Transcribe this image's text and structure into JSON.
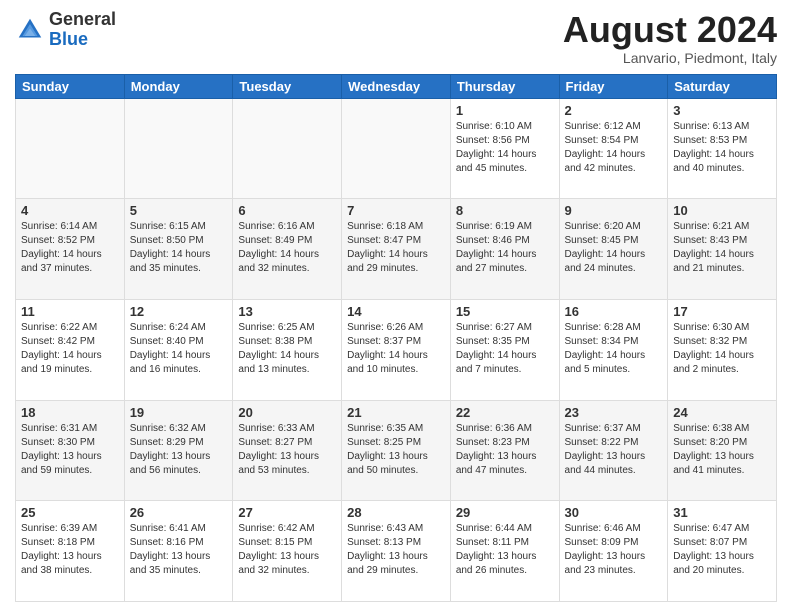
{
  "header": {
    "logo_general": "General",
    "logo_blue": "Blue",
    "month_title": "August 2024",
    "subtitle": "Lanvario, Piedmont, Italy"
  },
  "days_of_week": [
    "Sunday",
    "Monday",
    "Tuesday",
    "Wednesday",
    "Thursday",
    "Friday",
    "Saturday"
  ],
  "weeks": [
    [
      {
        "day": "",
        "info": ""
      },
      {
        "day": "",
        "info": ""
      },
      {
        "day": "",
        "info": ""
      },
      {
        "day": "",
        "info": ""
      },
      {
        "day": "1",
        "info": "Sunrise: 6:10 AM\nSunset: 8:56 PM\nDaylight: 14 hours\nand 45 minutes."
      },
      {
        "day": "2",
        "info": "Sunrise: 6:12 AM\nSunset: 8:54 PM\nDaylight: 14 hours\nand 42 minutes."
      },
      {
        "day": "3",
        "info": "Sunrise: 6:13 AM\nSunset: 8:53 PM\nDaylight: 14 hours\nand 40 minutes."
      }
    ],
    [
      {
        "day": "4",
        "info": "Sunrise: 6:14 AM\nSunset: 8:52 PM\nDaylight: 14 hours\nand 37 minutes."
      },
      {
        "day": "5",
        "info": "Sunrise: 6:15 AM\nSunset: 8:50 PM\nDaylight: 14 hours\nand 35 minutes."
      },
      {
        "day": "6",
        "info": "Sunrise: 6:16 AM\nSunset: 8:49 PM\nDaylight: 14 hours\nand 32 minutes."
      },
      {
        "day": "7",
        "info": "Sunrise: 6:18 AM\nSunset: 8:47 PM\nDaylight: 14 hours\nand 29 minutes."
      },
      {
        "day": "8",
        "info": "Sunrise: 6:19 AM\nSunset: 8:46 PM\nDaylight: 14 hours\nand 27 minutes."
      },
      {
        "day": "9",
        "info": "Sunrise: 6:20 AM\nSunset: 8:45 PM\nDaylight: 14 hours\nand 24 minutes."
      },
      {
        "day": "10",
        "info": "Sunrise: 6:21 AM\nSunset: 8:43 PM\nDaylight: 14 hours\nand 21 minutes."
      }
    ],
    [
      {
        "day": "11",
        "info": "Sunrise: 6:22 AM\nSunset: 8:42 PM\nDaylight: 14 hours\nand 19 minutes."
      },
      {
        "day": "12",
        "info": "Sunrise: 6:24 AM\nSunset: 8:40 PM\nDaylight: 14 hours\nand 16 minutes."
      },
      {
        "day": "13",
        "info": "Sunrise: 6:25 AM\nSunset: 8:38 PM\nDaylight: 14 hours\nand 13 minutes."
      },
      {
        "day": "14",
        "info": "Sunrise: 6:26 AM\nSunset: 8:37 PM\nDaylight: 14 hours\nand 10 minutes."
      },
      {
        "day": "15",
        "info": "Sunrise: 6:27 AM\nSunset: 8:35 PM\nDaylight: 14 hours\nand 7 minutes."
      },
      {
        "day": "16",
        "info": "Sunrise: 6:28 AM\nSunset: 8:34 PM\nDaylight: 14 hours\nand 5 minutes."
      },
      {
        "day": "17",
        "info": "Sunrise: 6:30 AM\nSunset: 8:32 PM\nDaylight: 14 hours\nand 2 minutes."
      }
    ],
    [
      {
        "day": "18",
        "info": "Sunrise: 6:31 AM\nSunset: 8:30 PM\nDaylight: 13 hours\nand 59 minutes."
      },
      {
        "day": "19",
        "info": "Sunrise: 6:32 AM\nSunset: 8:29 PM\nDaylight: 13 hours\nand 56 minutes."
      },
      {
        "day": "20",
        "info": "Sunrise: 6:33 AM\nSunset: 8:27 PM\nDaylight: 13 hours\nand 53 minutes."
      },
      {
        "day": "21",
        "info": "Sunrise: 6:35 AM\nSunset: 8:25 PM\nDaylight: 13 hours\nand 50 minutes."
      },
      {
        "day": "22",
        "info": "Sunrise: 6:36 AM\nSunset: 8:23 PM\nDaylight: 13 hours\nand 47 minutes."
      },
      {
        "day": "23",
        "info": "Sunrise: 6:37 AM\nSunset: 8:22 PM\nDaylight: 13 hours\nand 44 minutes."
      },
      {
        "day": "24",
        "info": "Sunrise: 6:38 AM\nSunset: 8:20 PM\nDaylight: 13 hours\nand 41 minutes."
      }
    ],
    [
      {
        "day": "25",
        "info": "Sunrise: 6:39 AM\nSunset: 8:18 PM\nDaylight: 13 hours\nand 38 minutes."
      },
      {
        "day": "26",
        "info": "Sunrise: 6:41 AM\nSunset: 8:16 PM\nDaylight: 13 hours\nand 35 minutes."
      },
      {
        "day": "27",
        "info": "Sunrise: 6:42 AM\nSunset: 8:15 PM\nDaylight: 13 hours\nand 32 minutes."
      },
      {
        "day": "28",
        "info": "Sunrise: 6:43 AM\nSunset: 8:13 PM\nDaylight: 13 hours\nand 29 minutes."
      },
      {
        "day": "29",
        "info": "Sunrise: 6:44 AM\nSunset: 8:11 PM\nDaylight: 13 hours\nand 26 minutes."
      },
      {
        "day": "30",
        "info": "Sunrise: 6:46 AM\nSunset: 8:09 PM\nDaylight: 13 hours\nand 23 minutes."
      },
      {
        "day": "31",
        "info": "Sunrise: 6:47 AM\nSunset: 8:07 PM\nDaylight: 13 hours\nand 20 minutes."
      }
    ]
  ]
}
